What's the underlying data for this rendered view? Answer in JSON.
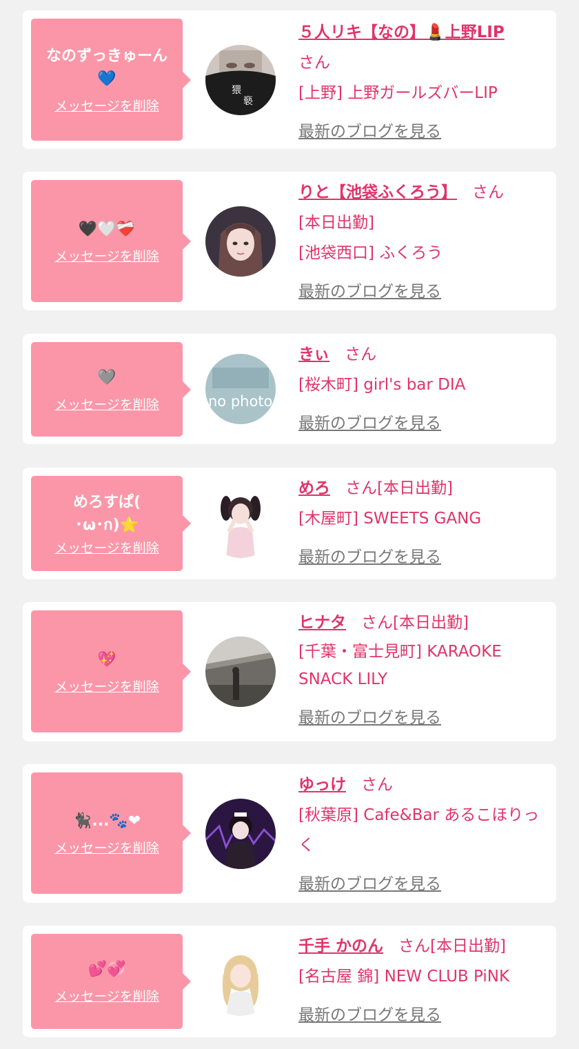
{
  "delete_label": "メッセージを削除",
  "blog_label": "最新のブログを見る",
  "san_label": "さん",
  "items": [
    {
      "message": "なのずっきゅーん\n💙",
      "name": "５人リキ【なの】💄上野LIP",
      "suffix": "",
      "shop": "[上野] 上野ガールズバーLIP"
    },
    {
      "message": "🖤🤍❤️‍🩹",
      "name": "りと【池袋ふくろう】",
      "suffix": "[本日出勤]",
      "shop": "[池袋西口] ふくろう"
    },
    {
      "message": "🩶",
      "name": "きぃ",
      "suffix": "",
      "shop": "[桜木町] girl's bar DIA"
    },
    {
      "message": "めろすぱ(\n･ω･ก)⭐",
      "name": "めろ",
      "suffix": "[本日出勤]",
      "shop": "[木屋町] SWEETS GANG"
    },
    {
      "message": "💖",
      "name": "ヒナタ",
      "suffix": "[本日出勤]",
      "shop": "[千葉・富士見町] KARAOKE SNACK LILY"
    },
    {
      "message": "🐈‍⬛...🐾❤",
      "name": "ゆっけ",
      "suffix": "",
      "shop": "[秋葉原] Cafe&Bar あるこほりっく"
    },
    {
      "message": "💕💞",
      "name": "千手 かのん",
      "suffix": "[本日出勤]",
      "shop": "[名古屋 錦] NEW CLUB PiNK"
    }
  ],
  "avatar_placeholder_text": "no photo",
  "colors": {
    "accent": "#e0336a",
    "bubble": "#fb96a8",
    "background": "#f1f1f1",
    "card": "#ffffff",
    "link_gray": "#777777"
  }
}
